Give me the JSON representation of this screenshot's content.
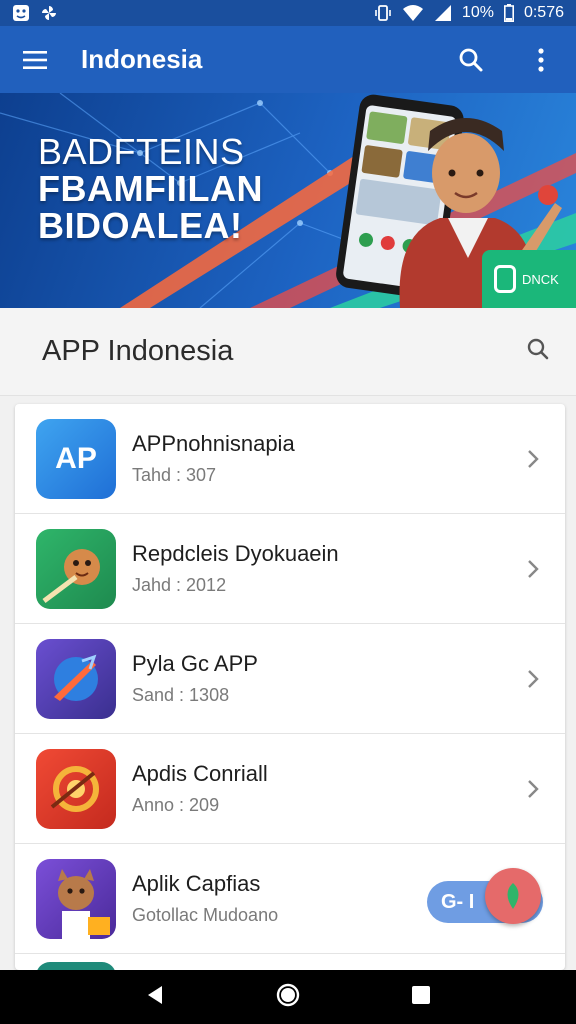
{
  "status_bar": {
    "battery_percent": "10%",
    "time": "0:576"
  },
  "app_bar": {
    "title": "Indonesia"
  },
  "banner": {
    "line1": "BADFTEINS",
    "line2": "FBAMFIILAN",
    "line3": "BIDOALEA!",
    "cta_label": "DNCK"
  },
  "search_header": {
    "label": "APP Indonesia"
  },
  "apps": [
    {
      "name": "APPnohnisnapia",
      "sub": "Tahd : 307",
      "icon_text": "AP",
      "color": "#2a86e0"
    },
    {
      "name": "Repdcleis Dyokuaein",
      "sub": "Jahd : 2012",
      "icon_text": "",
      "color": "#25a05f"
    },
    {
      "name": "Pyla Gc APP",
      "sub": "Sand : 1308",
      "icon_text": "",
      "color": "#5a47b8"
    },
    {
      "name": "Apdis Conriall",
      "sub": "Anno : 209",
      "icon_text": "",
      "color": "#e8432e"
    },
    {
      "name": "Aplik Capfias",
      "sub": "Gotollac Mudoano",
      "icon_text": "",
      "color": "#6a3eb0"
    }
  ],
  "floating_pill": {
    "label": "G- I"
  },
  "colors": {
    "status_bar": "#1a4f9e",
    "app_bar": "#2160bd",
    "accent_green": "#1bb77a"
  }
}
